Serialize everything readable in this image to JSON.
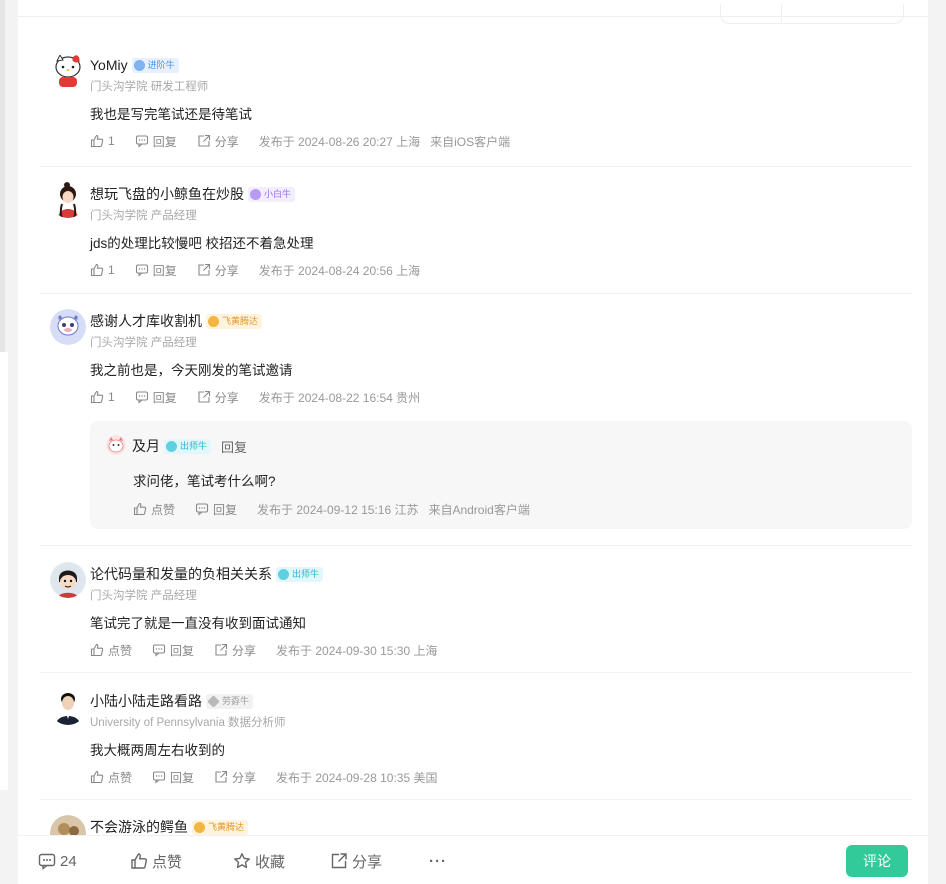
{
  "comments": [
    {
      "name": "YoMiy",
      "badge": "进阶牛",
      "subtitle": "门头沟学院 研发工程师",
      "content": "我也是写完笔试还是待笔试",
      "like": "1",
      "reply": "回复",
      "share": "分享",
      "time": "发布于 2024-08-26 20:27 上海",
      "source": "来自iOS客户端"
    },
    {
      "name": "想玩飞盘的小鲸鱼在炒股",
      "badge": "小白牛",
      "subtitle": "门头沟学院 产品经理",
      "content": "jds的处理比较慢吧 校招还不着急处理",
      "like": "1",
      "reply": "回复",
      "share": "分享",
      "time": "发布于 2024-08-24 20:56 上海"
    },
    {
      "name": "感谢人才库收割机",
      "badge": "飞黄腾达",
      "subtitle": "门头沟学院 产品经理",
      "content": "我之前也是，今天刚发的笔试邀请",
      "like": "1",
      "reply": "回复",
      "share": "分享",
      "time": "发布于 2024-08-22 16:54 贵州"
    },
    {
      "name": "论代码量和发量的负相关关系",
      "badge": "出师牛",
      "subtitle": "门头沟学院 产品经理",
      "content": "笔试完了就是一直没有收到面试通知",
      "like": "点赞",
      "reply": "回复",
      "share": "分享",
      "time": "发布于 2024-09-30 15:30 上海"
    },
    {
      "name": "小陆小陆走路看路",
      "badge": "劳孬牛",
      "subtitle": "University of Pennsylvania 数据分析师",
      "content": "我大概两周左右收到的",
      "like": "点赞",
      "reply": "回复",
      "share": "分享",
      "time": "发布于 2024-09-28 10:35 美国"
    },
    {
      "name": "不会游泳的鳄鱼",
      "badge": "飞黄腾达"
    }
  ],
  "reply": {
    "name": "及月",
    "badge": "出师牛",
    "reply_link": "回复",
    "content": "求问佬，笔试考什么啊?",
    "like": "点赞",
    "reply": "回复",
    "time": "发布于 2024-09-12 15:16 江苏",
    "source": "来自Android客户端"
  },
  "bottom_bar": {
    "comment_count": "24",
    "like": "点赞",
    "favorite": "收藏",
    "share": "分享",
    "more": "···",
    "comment_button": "评论"
  },
  "colors": {
    "accent": "#32ca99",
    "badge_blue": "#4a90e2",
    "badge_purple": "#9b6ef3",
    "badge_gold": "#f0a020",
    "badge_cyan": "#22b8cf",
    "badge_gray": "#9a9a9a"
  }
}
